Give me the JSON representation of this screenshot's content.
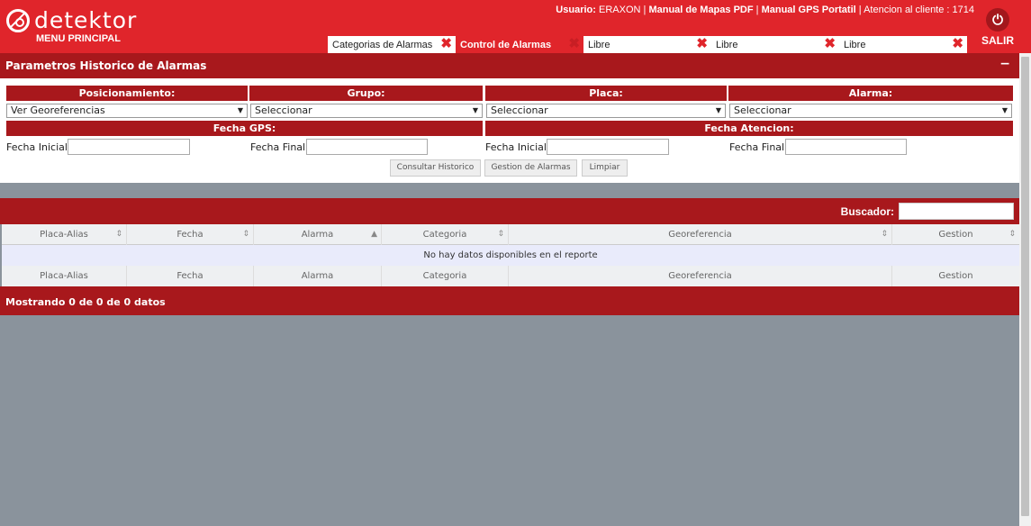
{
  "header": {
    "logo_text": "detektor",
    "menu_label": "MENU PRINCIPAL",
    "user_label": "Usuario:",
    "user_name": "ERAXON",
    "manual_mapas": "Manual de Mapas PDF",
    "manual_gps": "Manual GPS Portatil",
    "atencion": "Atencion al cliente : 1714",
    "separator": "|",
    "salir_label": "SALIR",
    "salir_icon": "⏻",
    "close_glyph": "✖",
    "tabs": [
      {
        "label": "Categorias de Alarmas"
      },
      {
        "label": "Control de Alarmas"
      },
      {
        "label": "Libre"
      },
      {
        "label": "Libre"
      },
      {
        "label": "Libre"
      }
    ]
  },
  "params": {
    "title": "Parametros Historico de Alarmas",
    "collapse_glyph": "−",
    "posicionamiento_header": "Posicionamiento:",
    "grupo_header": "Grupo:",
    "placa_header": "Placa:",
    "alarma_header": "Alarma:",
    "posicionamiento_value": "Ver Georeferencias",
    "grupo_value": "Seleccionar",
    "placa_value": "Seleccionar",
    "alarma_value": "Seleccionar",
    "dropdown_arrow": "▼",
    "fecha_gps_header": "Fecha GPS:",
    "fecha_atencion_header": "Fecha Atencion:",
    "fecha_inicial": "Fecha Inicial:",
    "fecha_final": "Fecha Final:",
    "btn_consultar": "Consultar Historico",
    "btn_gestion": "Gestion de Alarmas",
    "btn_limpiar": "Limpiar"
  },
  "table": {
    "search_label": "Buscador:",
    "columns": [
      "Placa-Alias",
      "Fecha",
      "Alarma",
      "Categoria",
      "Georeferencia",
      "Gestion"
    ],
    "sort_glyph": "⇕",
    "sort_asc_glyph": "▲",
    "empty_message": "No hay datos disponibles en el reporte",
    "footer_info": "Mostrando 0 de 0 de 0 datos"
  }
}
